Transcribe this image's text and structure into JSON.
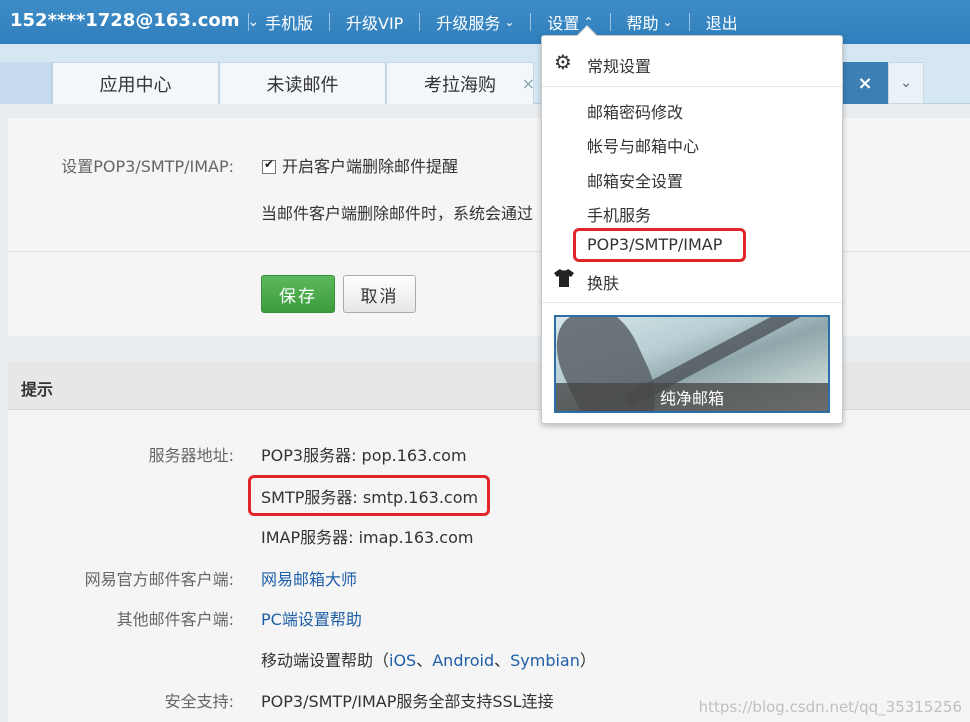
{
  "topbar": {
    "account": "152****1728@163.com",
    "account_caret": "⌄",
    "nav": [
      {
        "label": "手机版",
        "chev": ""
      },
      {
        "label": "升级VIP",
        "chev": ""
      },
      {
        "label": "升级服务",
        "chev": "⌄"
      },
      {
        "label": "设置",
        "chev": "⌃"
      },
      {
        "label": "帮助",
        "chev": "⌄"
      },
      {
        "label": "退出",
        "chev": ""
      }
    ]
  },
  "tabs": [
    {
      "label": "应用中心"
    },
    {
      "label": "未读邮件"
    },
    {
      "label": "考拉海购"
    }
  ],
  "tab_close": "×",
  "tab_active_close": "×",
  "tab_more": "⌄",
  "settings": {
    "label": "设置POP3/SMTP/IMAP:",
    "checkbox_label": "开启客户端删除邮件提醒",
    "desc": "当邮件客户端删除邮件时，系统会通过",
    "save": "保存",
    "cancel": "取消"
  },
  "hint": {
    "title": "提示",
    "server_label": "服务器地址:",
    "pop3": "POP3服务器: pop.163.com",
    "smtp": "SMTP服务器: smtp.163.com",
    "imap": "IMAP服务器: imap.163.com",
    "official_label": "网易官方邮件客户端:",
    "official_link": "网易邮箱大师",
    "other_label": "其他邮件客户端:",
    "other_link": "PC端设置帮助",
    "mobile_prefix": "移动端设置帮助（",
    "mobile_ios": "iOS",
    "mobile_sep1": "、",
    "mobile_android": "Android",
    "mobile_sep2": "、",
    "mobile_symbian": "Symbian",
    "mobile_suffix": "）",
    "security_label": "安全支持:",
    "security_value": "POP3/SMTP/IMAP服务全部支持SSL连接"
  },
  "dropdown": {
    "general": "常规设置",
    "items": [
      "邮箱密码修改",
      "帐号与邮箱中心",
      "邮箱安全设置",
      "手机服务",
      "POP3/SMTP/IMAP"
    ],
    "skin": "换肤",
    "skin_preview": "纯净邮箱"
  },
  "watermark": "https://blog.csdn.net/qq_35315256",
  "colors": {
    "topbar": "#2f7fbd",
    "link": "#1f5fa8",
    "save": "#3c9d3c",
    "highlight": "#e0262b"
  }
}
